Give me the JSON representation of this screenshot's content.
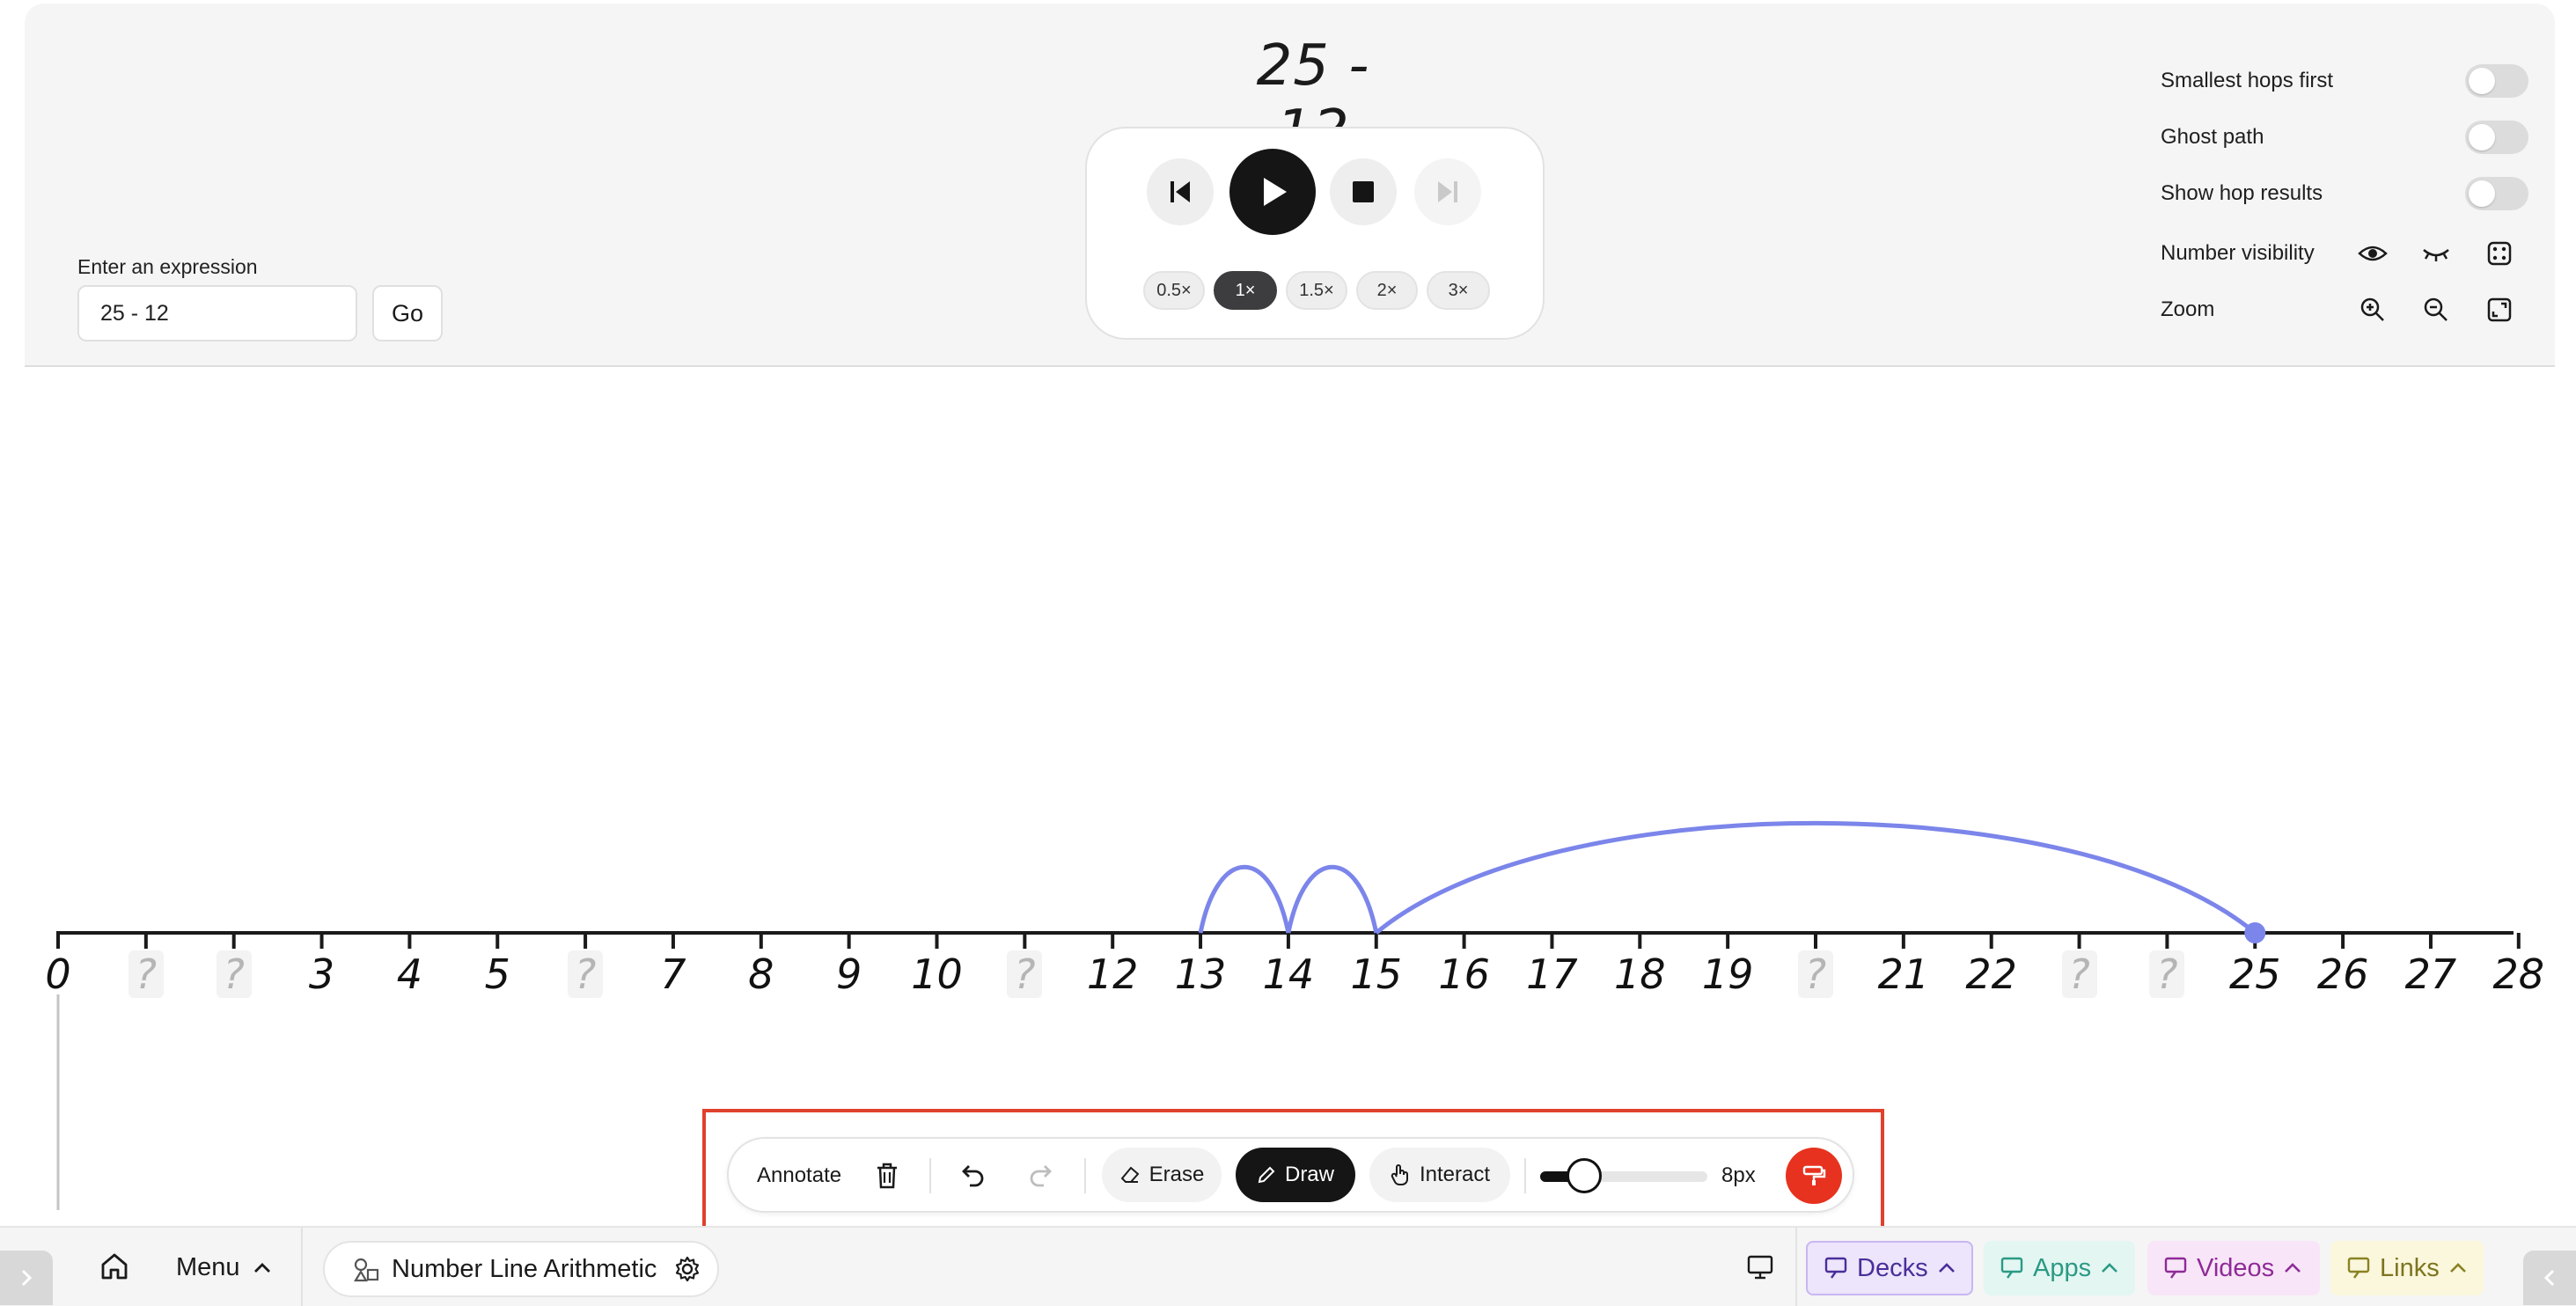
{
  "expression_title": "25 - 12",
  "expression_panel": {
    "label": "Enter an expression",
    "value": "25 - 12",
    "go_label": "Go"
  },
  "player": {
    "buttons": [
      "skip-back-icon",
      "play-icon",
      "stop-icon",
      "skip-forward-icon"
    ],
    "speeds": [
      "0.5×",
      "1×",
      "1.5×",
      "2×",
      "3×"
    ],
    "active_speed": "1×"
  },
  "settings": {
    "smallest_hops_first": {
      "label": "Smallest hops first",
      "on": false
    },
    "ghost_path": {
      "label": "Ghost path",
      "on": false
    },
    "show_hop_results": {
      "label": "Show hop results",
      "on": false
    },
    "number_visibility": {
      "label": "Number visibility",
      "icons": [
        "eye-icon",
        "eye-closed-icon",
        "dice-icon"
      ]
    },
    "zoom": {
      "label": "Zoom",
      "icons": [
        "zoom-in-icon",
        "zoom-out-icon",
        "fit-screen-icon"
      ]
    }
  },
  "number_line": {
    "labels": [
      "0",
      "?",
      "?",
      "3",
      "4",
      "5",
      "?",
      "7",
      "8",
      "9",
      "10",
      "?",
      "12",
      "13",
      "14",
      "15",
      "16",
      "17",
      "18",
      "19",
      "?",
      "21",
      "22",
      "?",
      "?",
      "25",
      "26",
      "27",
      "28"
    ],
    "start_value": 25,
    "hops": [
      [
        25,
        15
      ],
      [
        15,
        14
      ],
      [
        14,
        13
      ]
    ],
    "color": "#7b85ea"
  },
  "annotate_toolbar": {
    "title": "Annotate",
    "erase_label": "Erase",
    "draw_label": "Draw",
    "interact_label": "Interact",
    "active_tool": "Draw",
    "brush_size_label": "8px",
    "brush_size_value": 8,
    "brush_slider_fraction": 0.16,
    "pen_color": "#e7321f"
  },
  "bottom_bar": {
    "menu_label": "Menu",
    "app_name": "Number Line Arithmetic",
    "decks_label": "Decks",
    "apps_label": "Apps",
    "videos_label": "Videos",
    "links_label": "Links",
    "colors": {
      "decks": "#ece5fb",
      "apps": "#e3f6f2",
      "videos": "#f8e6f8",
      "links": "#fbf7dc"
    }
  }
}
